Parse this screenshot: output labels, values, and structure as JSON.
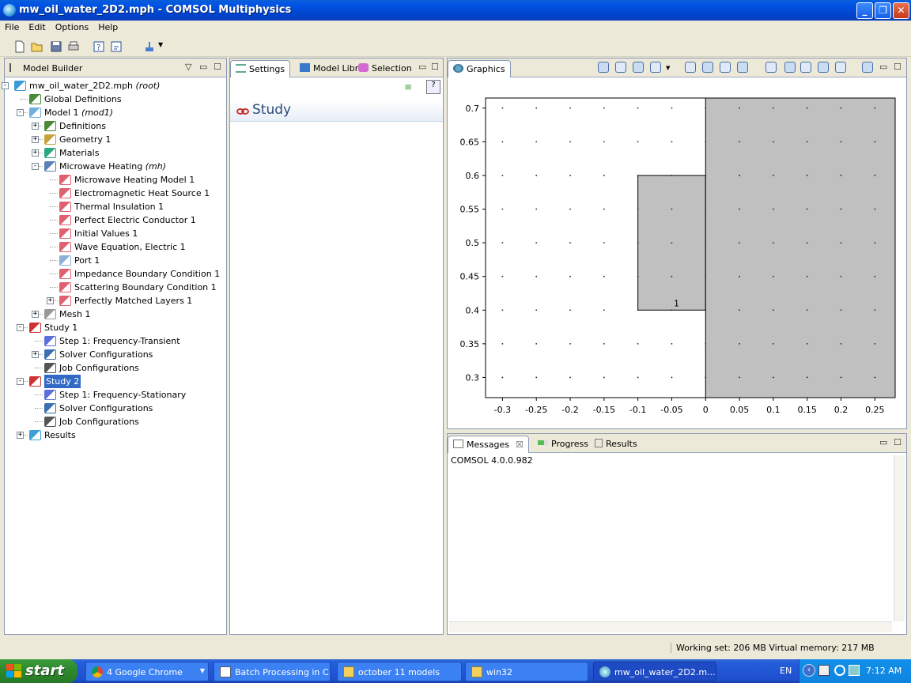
{
  "window": {
    "title": "mw_oil_water_2D2.mph - COMSOL Multiphysics",
    "buttons": [
      "minimize",
      "maximize",
      "close"
    ]
  },
  "menu": [
    "File",
    "Edit",
    "Options",
    "Help"
  ],
  "model_builder": {
    "tab_label": "Model Builder",
    "tree": [
      {
        "label": "mw_oil_water_2D2.mph",
        "suffix": "(root)",
        "icon": "root-icon"
      },
      {
        "label": "Global Definitions",
        "icon": "global-definitions-icon"
      },
      {
        "label": "Model 1",
        "suffix": "(mod1)",
        "icon": "model-icon"
      },
      {
        "label": "Definitions",
        "icon": "definitions-icon"
      },
      {
        "label": "Geometry 1",
        "icon": "geometry-icon"
      },
      {
        "label": "Materials",
        "icon": "materials-icon"
      },
      {
        "label": "Microwave Heating",
        "suffix": "(mh)",
        "icon": "physics-icon"
      },
      {
        "label": "Microwave Heating Model 1",
        "icon": "feature-icon"
      },
      {
        "label": "Electromagnetic Heat Source 1",
        "icon": "feature-icon"
      },
      {
        "label": "Thermal Insulation 1",
        "icon": "feature-icon"
      },
      {
        "label": "Perfect Electric Conductor 1",
        "icon": "feature-icon"
      },
      {
        "label": "Initial Values 1",
        "icon": "feature-icon"
      },
      {
        "label": "Wave Equation, Electric 1",
        "icon": "feature-icon"
      },
      {
        "label": "Port 1",
        "icon": "port-icon"
      },
      {
        "label": "Impedance Boundary Condition 1",
        "icon": "feature-icon"
      },
      {
        "label": "Scattering Boundary Condition 1",
        "icon": "feature-icon"
      },
      {
        "label": "Perfectly Matched Layers 1",
        "icon": "feature-icon"
      },
      {
        "label": "Mesh 1",
        "icon": "mesh-icon"
      },
      {
        "label": "Study 1",
        "icon": "study-icon"
      },
      {
        "label": "Step 1: Frequency-Transient",
        "icon": "step-icon"
      },
      {
        "label": "Solver Configurations",
        "icon": "solver-icon"
      },
      {
        "label": "Job Configurations",
        "icon": "job-icon"
      },
      {
        "label": "Study 2",
        "icon": "study-icon",
        "selected": true
      },
      {
        "label": "Step 1: Frequency-Stationary",
        "icon": "step-icon"
      },
      {
        "label": "Solver Configurations",
        "icon": "solver-icon"
      },
      {
        "label": "Job Configurations",
        "icon": "job-icon"
      },
      {
        "label": "Results",
        "icon": "results-icon"
      }
    ]
  },
  "settings": {
    "tabs": [
      "Settings",
      "Model Libr",
      "Selection"
    ],
    "heading": "Study"
  },
  "graphics": {
    "tab_label": "Graphics",
    "domain_label": "1"
  },
  "chart_data": {
    "type": "geometry",
    "x_ticks": [
      "-0.3",
      "-0.25",
      "-0.2",
      "-0.15",
      "-0.1",
      "-0.05",
      "0",
      "0.05",
      "0.1",
      "0.15",
      "0.2",
      "0.25"
    ],
    "y_ticks": [
      "0.7",
      "0.65",
      "0.6",
      "0.55",
      "0.5",
      "0.45",
      "0.4",
      "0.35",
      "0.3"
    ],
    "xlim": [
      -0.325,
      0.28
    ],
    "ylim": [
      0.27,
      0.715
    ],
    "grid_dot_spacing": 0.05,
    "rectangles": [
      {
        "name": "domain-1",
        "x0": -0.1,
        "x1": 0,
        "y0": 0.4,
        "y1": 0.6,
        "label": "1"
      },
      {
        "name": "domain-2",
        "x0": 0,
        "x1": 0.28,
        "y0": 0.27,
        "y1": 0.715,
        "label": ""
      }
    ],
    "fill": "#c0c0c0"
  },
  "messages": {
    "tabs": [
      "Messages",
      "Progress",
      "Results"
    ],
    "text": "COMSOL 4.0.0.982"
  },
  "status": {
    "text": "Working set: 206 MB  Virtual memory: 217 MB"
  },
  "taskbar": {
    "start_label": "start",
    "tasks": [
      {
        "label": "4 Google Chrome",
        "icon": "chrome-icon"
      },
      {
        "label": "Batch Processing in C...",
        "icon": "document-icon"
      },
      {
        "label": "october 11 models",
        "icon": "folder-icon"
      },
      {
        "label": "win32",
        "icon": "folder-icon"
      },
      {
        "label": "mw_oil_water_2D2.m...",
        "icon": "comsol-icon",
        "active": true
      }
    ],
    "language": "EN",
    "clock": "7:12 AM"
  }
}
